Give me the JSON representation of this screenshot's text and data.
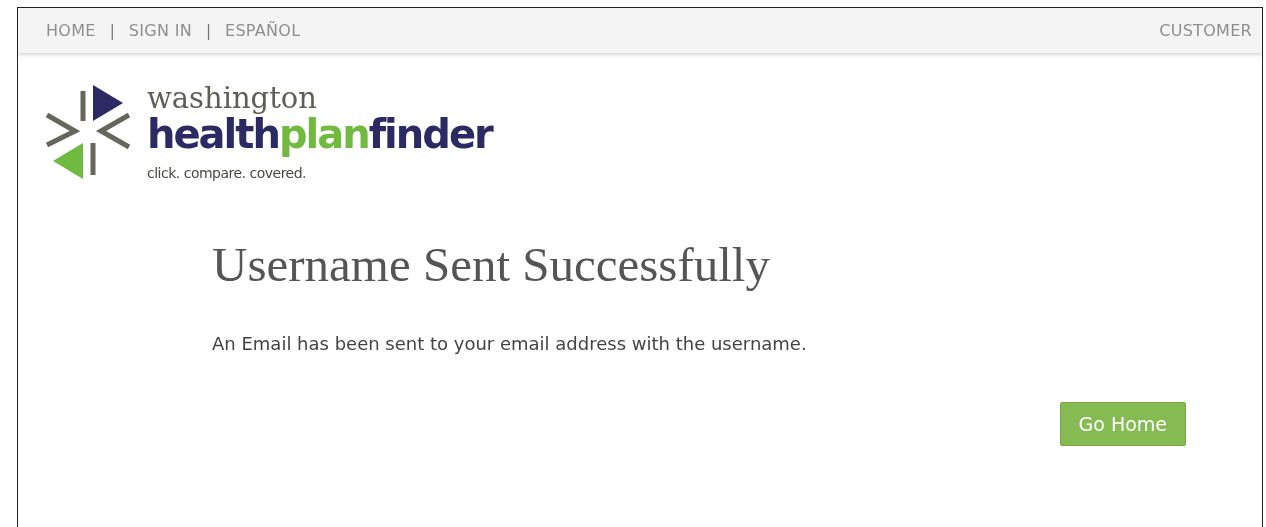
{
  "top_nav": {
    "links": [
      "HOME",
      "SIGN IN",
      "ESPAÑOL"
    ],
    "separator": "|",
    "right_link": "CUSTOMER"
  },
  "logo": {
    "line_1": "washington",
    "wordmark": [
      {
        "text": "health",
        "color": "#2b2a63"
      },
      {
        "text": "plan",
        "color": "#6fba3f"
      },
      {
        "text": "finder",
        "color": "#2b2a63"
      }
    ],
    "tagline": "click. compare. covered."
  },
  "heading": "Username Sent Successfully",
  "message": "An Email has been sent to your email address with the username.",
  "button": "Go Home"
}
